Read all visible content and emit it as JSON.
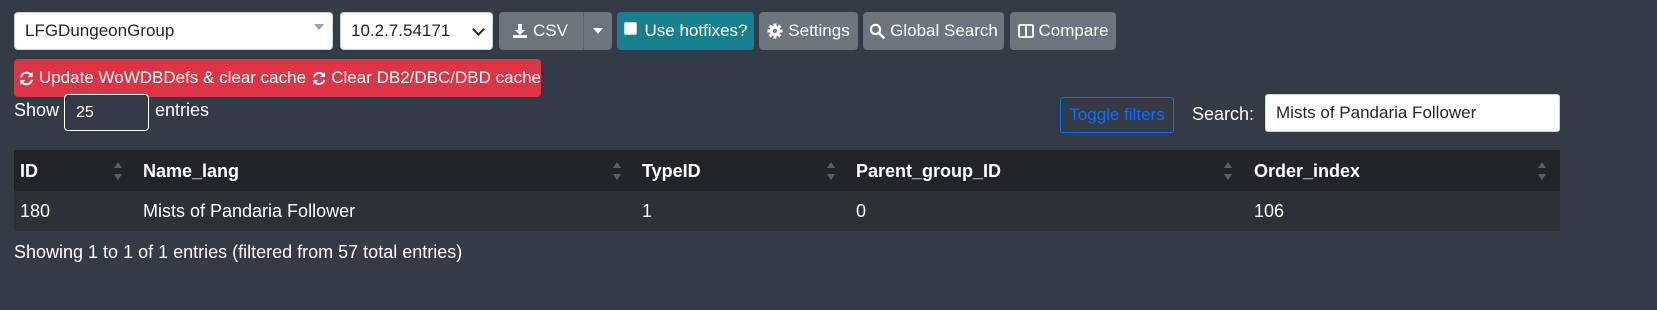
{
  "toolbar": {
    "table_select": "LFGDungeonGroup",
    "build_select": "10.2.7.54171",
    "csv_label": "CSV",
    "hotfixes_label": "Use hotfixes?",
    "settings_label": "Settings",
    "global_search_label": "Global Search",
    "compare_label": "Compare",
    "update_label": "Update WoWDBDefs & clear cache",
    "clear_label": "Clear DB2/DBC/DBD cache"
  },
  "length": {
    "show_label": "Show",
    "value": "25",
    "entries_label": "entries"
  },
  "filters": {
    "toggle_label": "Toggle filters",
    "search_label": "Search:",
    "search_value": "Mists of Pandaria Follower"
  },
  "table": {
    "columns": [
      "ID",
      "Name_lang",
      "TypeID",
      "Parent_group_ID",
      "Order_index"
    ],
    "rows": [
      [
        "180",
        "Mists of Pandaria Follower",
        "1",
        "0",
        "106"
      ]
    ]
  },
  "info_text": "Showing 1 to 1 of 1 entries (filtered from 57 total entries)",
  "colors": {
    "background": "#343a46",
    "btn_grey": "#6c757d",
    "btn_teal": "#17808f",
    "btn_red": "#dc3545",
    "link_blue": "#0d6efd"
  },
  "icons": [
    "download-icon",
    "caret-down-icon",
    "gear-icon",
    "search-icon",
    "columns-icon",
    "refresh-icon"
  ]
}
